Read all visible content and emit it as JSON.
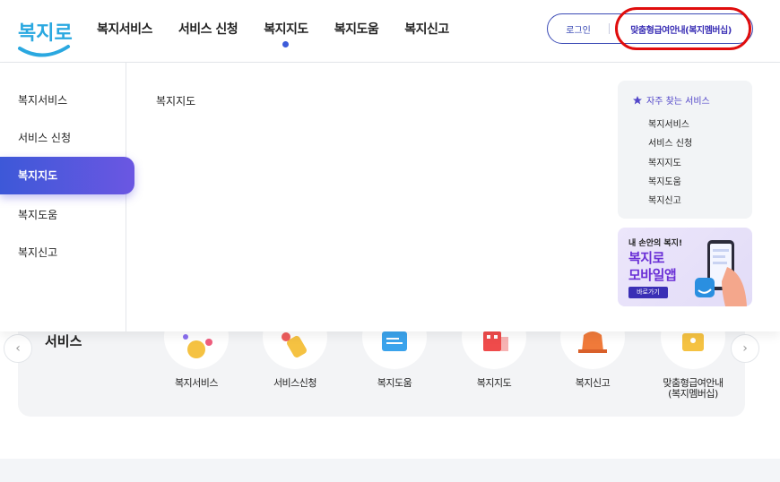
{
  "brand": {
    "logo_text": "복지로",
    "accent": "#3c5bd9",
    "highlight_color": "#e00d0d"
  },
  "gnb": {
    "items": [
      {
        "label": "복지서비스",
        "active": false
      },
      {
        "label": "서비스 신청",
        "active": false
      },
      {
        "label": "복지지도",
        "active": true
      },
      {
        "label": "복지도움",
        "active": false
      },
      {
        "label": "복지신고",
        "active": false
      }
    ]
  },
  "util": {
    "login_label": "로그인",
    "member_label": "맞춤형급여안내(복지멤버십)"
  },
  "mega_menu": {
    "side_items": [
      {
        "label": "복지서비스",
        "active": false
      },
      {
        "label": "서비스 신청",
        "active": false
      },
      {
        "label": "복지지도",
        "active": true
      },
      {
        "label": "복지도움",
        "active": false
      },
      {
        "label": "복지신고",
        "active": false
      }
    ],
    "sub_title": "복지지도",
    "frequent": {
      "title": "자주 찾는 서비스",
      "items": [
        "복지서비스",
        "서비스 신청",
        "복지지도",
        "복지도움",
        "복지신고"
      ]
    },
    "banner": {
      "subtitle": "내 손안의 복지!",
      "title_line1": "복지로",
      "title_line2": "모바일앱",
      "button_label": "바로가기"
    }
  },
  "service": {
    "title": "서비스",
    "items": [
      {
        "label": "복지서비스",
        "icon": "person-icon"
      },
      {
        "label": "서비스신청",
        "icon": "hand-pointer-icon"
      },
      {
        "label": "복지도움",
        "icon": "document-icon"
      },
      {
        "label": "복지지도",
        "icon": "map-building-icon"
      },
      {
        "label": "복지신고",
        "icon": "siren-icon"
      },
      {
        "label": "맞춤형급여안내\n(복지멤버십)",
        "label_line1": "맞춤형급여안내",
        "label_line2": "(복지멤버십)",
        "icon": "card-icon"
      }
    ]
  }
}
